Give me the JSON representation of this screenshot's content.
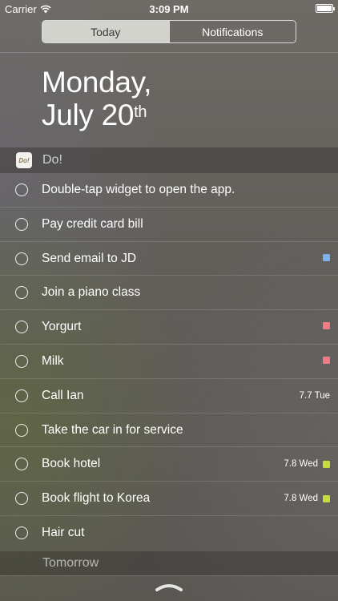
{
  "status_bar": {
    "carrier": "Carrier",
    "time": "3:09 PM"
  },
  "segmented_control": {
    "tabs": [
      {
        "label": "Today",
        "selected": true
      },
      {
        "label": "Notifications",
        "selected": false
      }
    ]
  },
  "date": {
    "weekday": "Monday,",
    "month_day": "July 20",
    "suffix": "th"
  },
  "widget": {
    "app_name": "Do!",
    "icon_text": "Do!",
    "tasks": [
      {
        "label": "Double-tap widget to open the app.",
        "due": "",
        "tag_color": ""
      },
      {
        "label": "Pay credit card bill",
        "due": "",
        "tag_color": ""
      },
      {
        "label": "Send email to JD",
        "due": "",
        "tag_color": "#7fb3f0"
      },
      {
        "label": "Join a piano class",
        "due": "",
        "tag_color": ""
      },
      {
        "label": "Yorgurt",
        "due": "",
        "tag_color": "#f07a86"
      },
      {
        "label": "Milk",
        "due": "",
        "tag_color": "#f07a86"
      },
      {
        "label": "Call Ian",
        "due": "7.7 Tue",
        "tag_color": ""
      },
      {
        "label": "Take the car in for service",
        "due": "",
        "tag_color": ""
      },
      {
        "label": "Book hotel",
        "due": "7.8 Wed",
        "tag_color": "#c8dd3c"
      },
      {
        "label": "Book flight to Korea",
        "due": "7.8 Wed",
        "tag_color": "#c8dd3c"
      },
      {
        "label": "Hair cut",
        "due": "",
        "tag_color": ""
      }
    ]
  },
  "tomorrow": {
    "label": "Tomorrow"
  }
}
